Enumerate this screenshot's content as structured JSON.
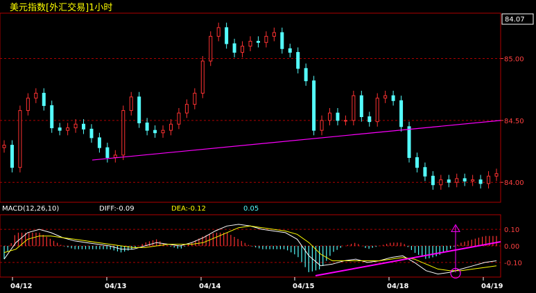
{
  "window_title": "美元指数[外汇交易]1小时",
  "last_price_box": "84.07",
  "indicator_strip": {
    "macd_label": "MACD(12,26,10)",
    "diff_label": "DIFF:-0.09",
    "dea_label": "DEA:-0.12",
    "macd_value": "0.05"
  },
  "colors": {
    "up": "#ff3232",
    "down": "#54fcfc",
    "grid": "#b00000",
    "trendline": "#ff00ff",
    "dif_line": "#ffffff",
    "dea_line": "#ffff00",
    "axis_text": "#ff4040",
    "date_text": "#ffffff",
    "strip_white": "#ffffff",
    "strip_yellow": "#ffff00",
    "strip_cyan": "#54fcfc"
  },
  "chart_data": [
    {
      "type": "candlestick",
      "title": "",
      "x": [
        "04/12",
        "04/13",
        "04/14",
        "04/15",
        "04/18",
        "04/19"
      ],
      "ylim": [
        83.85,
        85.35
      ],
      "y_ticks": [
        "85.00",
        "84.50",
        "84.00"
      ],
      "close_path": [
        84.3,
        84.12,
        84.58,
        84.68,
        84.72,
        84.62,
        84.44,
        84.42,
        84.44,
        84.47,
        84.43,
        84.36,
        84.28,
        84.2,
        84.22,
        84.58,
        84.69,
        84.48,
        84.42,
        84.4,
        84.42,
        84.47,
        84.56,
        84.63,
        84.72,
        84.98,
        85.18,
        85.25,
        85.12,
        85.05,
        85.1,
        85.14,
        85.13,
        85.18,
        85.21,
        85.08,
        85.05,
        84.92,
        84.82,
        84.42,
        84.5,
        84.56,
        84.5,
        84.5,
        84.7,
        84.53,
        84.49,
        84.68,
        84.7,
        84.66,
        84.45,
        84.2,
        84.12,
        84.05,
        83.98,
        84.02,
        84.0,
        84.03,
        84.01,
        84.02,
        83.99,
        84.05,
        84.07
      ],
      "trendlines": [
        {
          "from": [
            "04/12",
            84.18
          ],
          "to": [
            "04/19",
            84.5
          ]
        }
      ]
    },
    {
      "type": "bar+line",
      "title": "MACD(12,26,10)",
      "ylim": [
        -0.18,
        0.18
      ],
      "y_ticks": [
        "0.10",
        "0.00",
        "-0.10"
      ],
      "x": [
        "04/12",
        "04/13",
        "04/14",
        "04/15",
        "04/18",
        "04/19"
      ],
      "dif_path": [
        -0.08,
        0.02,
        0.08,
        0.1,
        0.08,
        0.05,
        0.03,
        0.02,
        0.01,
        0.0,
        -0.02,
        -0.02,
        0.0,
        0.02,
        0.01,
        0.0,
        0.02,
        0.05,
        0.09,
        0.12,
        0.13,
        0.12,
        0.1,
        0.09,
        0.08,
        0.04,
        -0.06,
        -0.12,
        -0.11,
        -0.09,
        -0.08,
        -0.1,
        -0.09,
        -0.07,
        -0.06,
        -0.1,
        -0.15,
        -0.17,
        -0.16,
        -0.14,
        -0.12,
        -0.1,
        -0.09
      ],
      "dea_path": [
        -0.04,
        -0.02,
        0.04,
        0.06,
        0.06,
        0.05,
        0.04,
        0.03,
        0.02,
        0.01,
        0.0,
        -0.01,
        -0.01,
        0.0,
        0.01,
        0.01,
        0.01,
        0.02,
        0.05,
        0.08,
        0.11,
        0.12,
        0.11,
        0.1,
        0.09,
        0.07,
        0.02,
        -0.05,
        -0.09,
        -0.09,
        -0.09,
        -0.09,
        -0.09,
        -0.08,
        -0.07,
        -0.08,
        -0.11,
        -0.14,
        -0.15,
        -0.15,
        -0.14,
        -0.13,
        -0.12
      ],
      "trendlines": [
        {
          "from": [
            "04/15",
            -0.18
          ],
          "to": [
            "04/19",
            0.0
          ]
        }
      ],
      "markers": [
        {
          "type": "circle",
          "at": [
            "04/18",
            -0.165
          ]
        },
        {
          "type": "up-arrow",
          "at": [
            "04/18",
            0.12
          ]
        }
      ]
    }
  ]
}
